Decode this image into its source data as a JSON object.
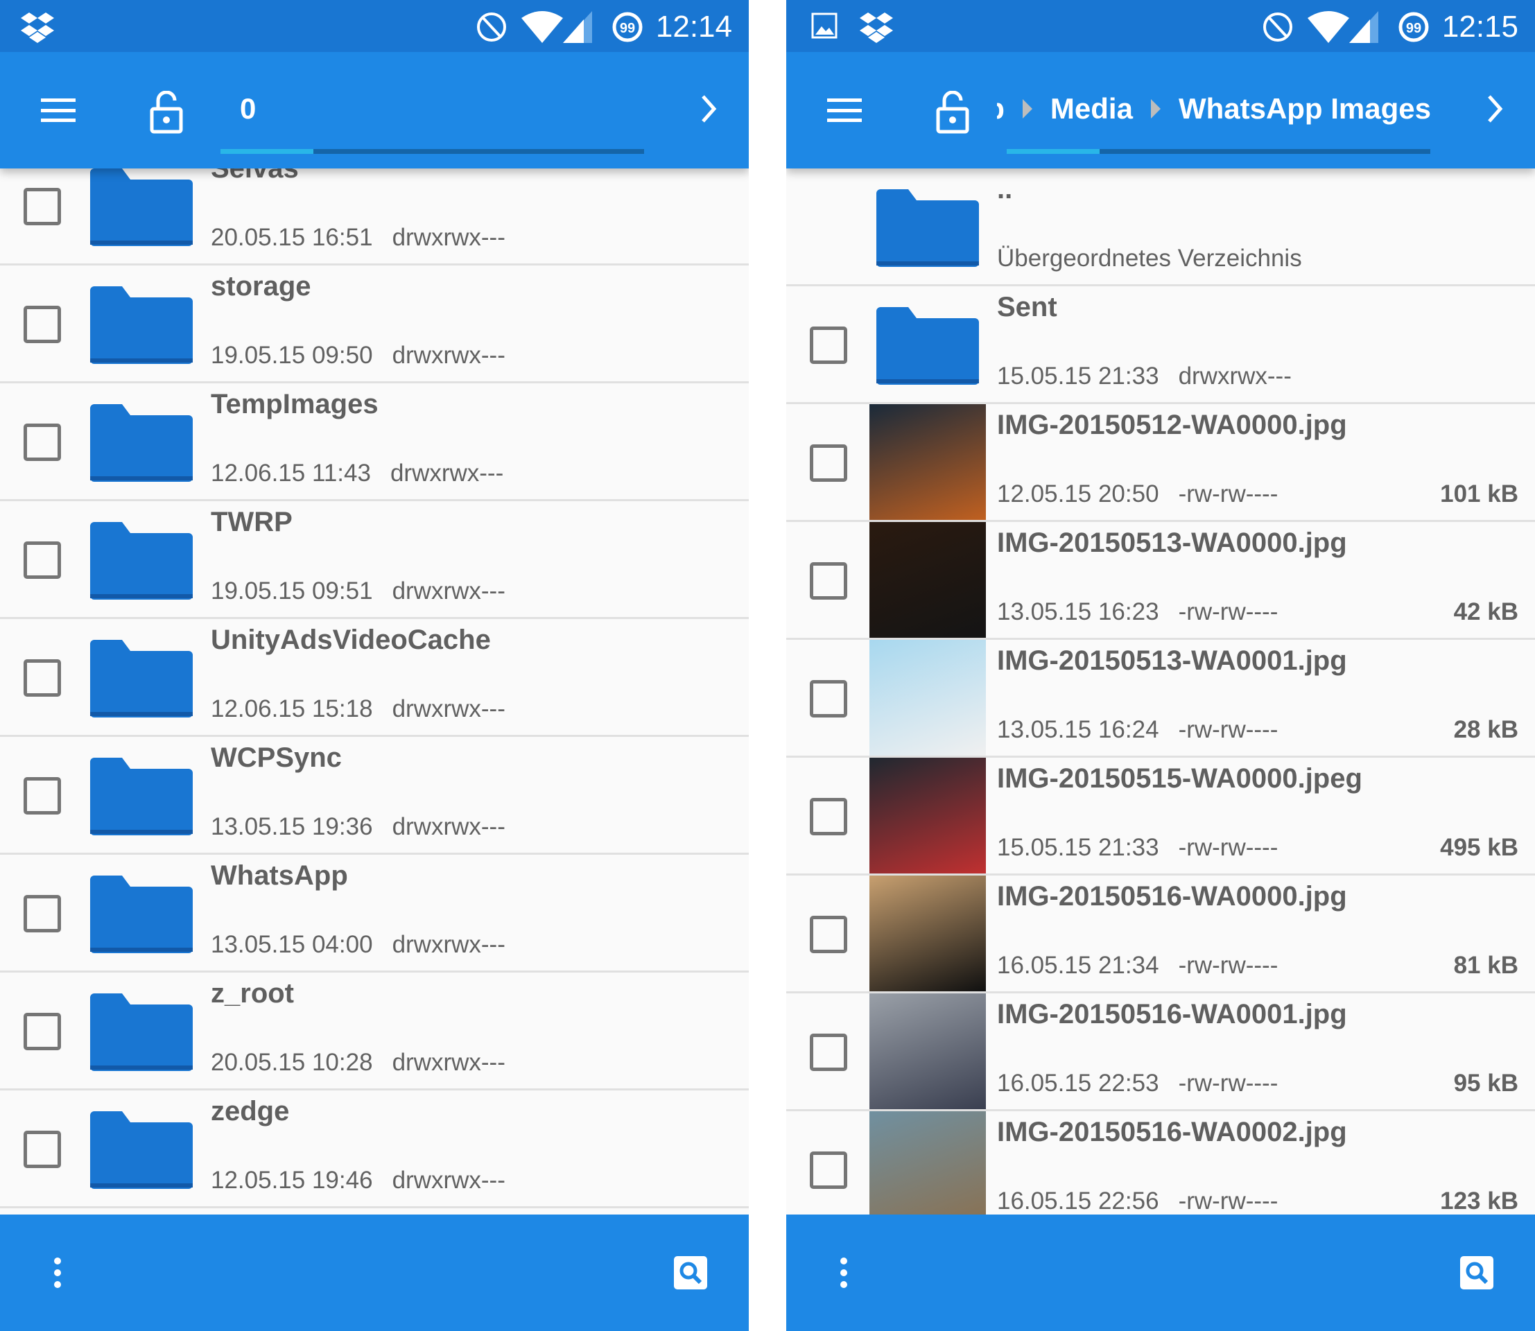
{
  "colors": {
    "status_bar": "#1976d2",
    "toolbar": "#1e88e5",
    "folder": "#1976d2",
    "text": "#616161"
  },
  "left": {
    "status": {
      "time": "12:14",
      "icons": [
        "dropbox-icon",
        "do-not-disturb-icon",
        "wifi-icon",
        "signal-icon",
        "badge-99-icon"
      ]
    },
    "toolbar": {
      "crumbs": [
        "0"
      ],
      "scroll_progress": 0.22
    },
    "rows": [
      {
        "name": "Selvas",
        "date": "20.05.15 16:51",
        "perm": "drwxrwx---"
      },
      {
        "name": "storage",
        "date": "19.05.15 09:50",
        "perm": "drwxrwx---"
      },
      {
        "name": "TempImages",
        "date": "12.06.15 11:43",
        "perm": "drwxrwx---"
      },
      {
        "name": "TWRP",
        "date": "19.05.15 09:51",
        "perm": "drwxrwx---"
      },
      {
        "name": "UnityAdsVideoCache",
        "date": "12.06.15 15:18",
        "perm": "drwxrwx---"
      },
      {
        "name": "WCPSync",
        "date": "13.05.15 19:36",
        "perm": "drwxrwx---"
      },
      {
        "name": "WhatsApp",
        "date": "13.05.15 04:00",
        "perm": "drwxrwx---"
      },
      {
        "name": "z_root",
        "date": "20.05.15 10:28",
        "perm": "drwxrwx---"
      },
      {
        "name": "zedge",
        "date": "12.05.15 19:46",
        "perm": "drwxrwx---"
      }
    ]
  },
  "right": {
    "status": {
      "time": "12:15",
      "icons": [
        "image-icon",
        "dropbox-icon",
        "do-not-disturb-icon",
        "wifi-icon",
        "signal-icon",
        "badge-99-icon"
      ]
    },
    "toolbar": {
      "crumbs": [
        "WhatsApp",
        "Media",
        "WhatsApp Images"
      ],
      "scroll_progress": 0.22
    },
    "parent": {
      "name": "..",
      "label": "Übergeordnetes Verzeichnis"
    },
    "rows": [
      {
        "type": "folder",
        "name": "Sent",
        "date": "15.05.15 21:33",
        "perm": "drwxrwx---"
      },
      {
        "type": "image",
        "name": "IMG-20150512-WA0000.jpg",
        "date": "12.05.15 20:50",
        "perm": "-rw-rw----",
        "size": "101 kB",
        "thumb": [
          "#1a2a3a",
          "#c06020"
        ]
      },
      {
        "type": "image",
        "name": "IMG-20150513-WA0000.jpg",
        "date": "13.05.15 16:23",
        "perm": "-rw-rw----",
        "size": "42 kB",
        "thumb": [
          "#2a1a10",
          "#141414"
        ]
      },
      {
        "type": "image",
        "name": "IMG-20150513-WA0001.jpg",
        "date": "13.05.15 16:24",
        "perm": "-rw-rw----",
        "size": "28 kB",
        "thumb": [
          "#a8d8ef",
          "#f0f0f0"
        ]
      },
      {
        "type": "image",
        "name": "IMG-20150515-WA0000.jpeg",
        "date": "15.05.15 21:33",
        "perm": "-rw-rw----",
        "size": "495 kB",
        "thumb": [
          "#202830",
          "#c03030"
        ]
      },
      {
        "type": "image",
        "name": "IMG-20150516-WA0000.jpg",
        "date": "16.05.15 21:34",
        "perm": "-rw-rw----",
        "size": "81 kB",
        "thumb": [
          "#c8a070",
          "#101010"
        ]
      },
      {
        "type": "image",
        "name": "IMG-20150516-WA0001.jpg",
        "date": "16.05.15 22:53",
        "perm": "-rw-rw----",
        "size": "95 kB",
        "thumb": [
          "#9aa0a8",
          "#3a3f50"
        ]
      },
      {
        "type": "image",
        "name": "IMG-20150516-WA0002.jpg",
        "date": "16.05.15 22:56",
        "perm": "-rw-rw----",
        "size": "123 kB",
        "thumb": [
          "#7090a0",
          "#8a7050"
        ]
      }
    ]
  }
}
